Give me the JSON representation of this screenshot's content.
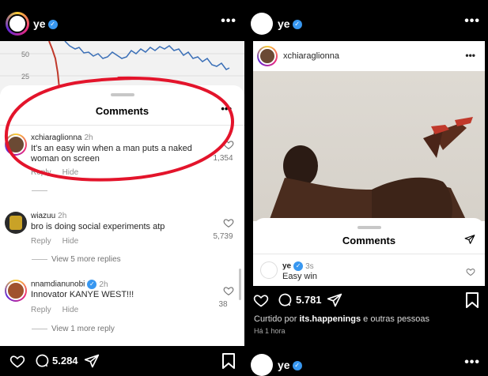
{
  "left": {
    "header": {
      "username": "ye",
      "more": "•••"
    },
    "chart_ticks": [
      "50",
      "25"
    ],
    "comments_sheet": {
      "title": "Comments",
      "more": "•••",
      "comments": [
        {
          "user": "xchiaraglionna",
          "time": "2h",
          "text": "It's an easy win when a man puts a naked woman on screen",
          "reply": "Reply",
          "hide": "Hide",
          "likes": "1,354"
        },
        {
          "user": "wiazuu",
          "time": "2h",
          "text": "bro is doing social experiments atp",
          "reply": "Reply",
          "hide": "Hide",
          "likes": "5,739",
          "view_replies": "View 5 more replies"
        },
        {
          "user": "nnamdianunobi",
          "time": "2h",
          "text": "Innovator KANYE WEST!!!",
          "reply": "Reply",
          "hide": "Hide",
          "likes": "38",
          "view_replies": "View 1 more reply"
        }
      ]
    },
    "actions": {
      "comments_count": "5.284"
    }
  },
  "right": {
    "header": {
      "username": "ye",
      "more": "•••"
    },
    "post": {
      "user": "xchiaraglionna",
      "more": "•••"
    },
    "comments_sheet": {
      "title": "Comments",
      "comment": {
        "user": "ye",
        "time": "3s",
        "text": "Easy win"
      }
    },
    "actions": {
      "comments_count": "5.781"
    },
    "liked_by": {
      "prefix": "Curtido por",
      "user": "its.happenings",
      "suffix": "e outras pessoas"
    },
    "time_ago": "Há 1 hora",
    "bottom_user": "ye"
  },
  "colors": {
    "verified": "#3897f0",
    "annotation_red": "#e3142b",
    "background": "#000000"
  }
}
